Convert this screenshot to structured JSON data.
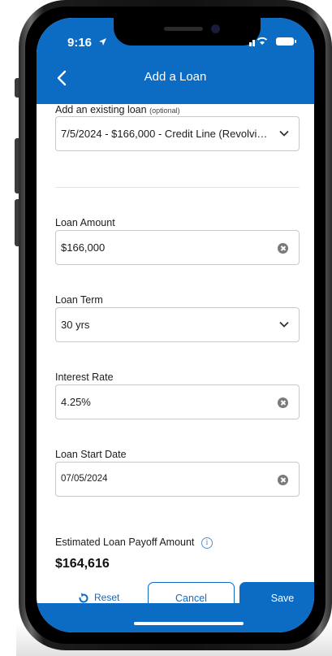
{
  "status_bar": {
    "time": "9:16"
  },
  "header": {
    "title": "Add a Loan",
    "back_icon": "chevron-left-icon"
  },
  "existing_loan": {
    "label": "Add an existing loan",
    "optional_label": "(optional)",
    "value": "7/5/2024 - $166,000 - Credit Line (Revolvi…"
  },
  "loan_amount": {
    "label": "Loan Amount",
    "value": "$166,000"
  },
  "loan_term": {
    "label": "Loan Term",
    "value": "30 yrs"
  },
  "interest_rate": {
    "label": "Interest Rate",
    "value": "4.25%"
  },
  "loan_start_date": {
    "label": "Loan Start Date",
    "value": "07/05/2024"
  },
  "payoff": {
    "label": "Estimated Loan Payoff Amount",
    "amount": "$164,616",
    "info_icon": "i"
  },
  "actions": {
    "reset": "Reset",
    "cancel": "Cancel",
    "save": "Save"
  },
  "colors": {
    "primary": "#0c6cc4",
    "field_border": "#c9c9c9",
    "clear_icon": "#7a7a7a"
  }
}
